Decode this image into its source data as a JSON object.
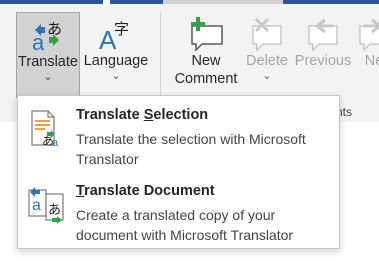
{
  "ribbon": {
    "translate": {
      "label": "Translate",
      "chevron": "⌄",
      "icon": "translate-icon"
    },
    "language": {
      "label": "Language",
      "chevron": "⌄",
      "icon": "language-icon"
    },
    "new_comment": {
      "label_line1": "New",
      "label_line2": "Comment",
      "icon": "new-comment-icon"
    },
    "delete": {
      "label": "Delete",
      "chevron": "⌄",
      "icon": "delete-comment-icon"
    },
    "previous": {
      "label": "Previous",
      "icon": "previous-comment-icon"
    },
    "next": {
      "label": "Ne",
      "icon": "next-comment-icon"
    },
    "group_label": "nts"
  },
  "menu": {
    "items": [
      {
        "title_pre": "Translate ",
        "title_accel": "S",
        "title_post": "election",
        "desc": "Translate the selection with Microsoft Translator",
        "icon": "translate-selection-icon"
      },
      {
        "title_pre": "",
        "title_accel": "T",
        "title_post": "ranslate Document",
        "desc": "Create a translated copy of your document with Microsoft Translator",
        "icon": "translate-document-icon"
      }
    ]
  },
  "colors": {
    "accent_blue": "#2b579a",
    "icon_blue": "#2e73b8",
    "icon_green": "#33a04a",
    "ribbon_bg": "#f3f3f3",
    "pressed_bg": "#d2d2d2",
    "disabled_text": "#a6a6a6"
  }
}
